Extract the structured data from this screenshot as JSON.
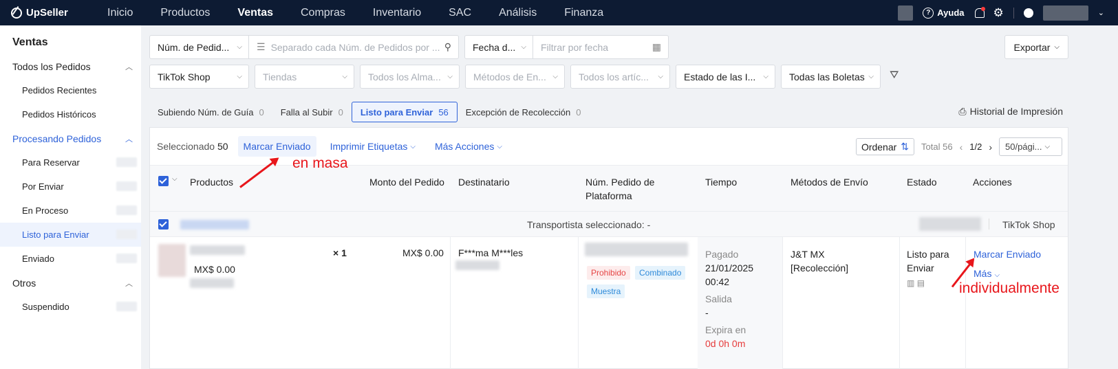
{
  "app": {
    "logo": "UpSeller"
  },
  "nav": [
    "Inicio",
    "Productos",
    "Ventas",
    "Compras",
    "Inventario",
    "SAC",
    "Análisis",
    "Finanza"
  ],
  "nav_active": "Ventas",
  "top_right": {
    "help": "Ayuda"
  },
  "sidebar": {
    "title": "Ventas",
    "groups": [
      {
        "label": "Todos los Pedidos",
        "items": [
          "Pedidos Recientes",
          "Pedidos Históricos"
        ]
      },
      {
        "label": "Procesando Pedidos",
        "items": [
          "Para Reservar",
          "Por Enviar",
          "En Proceso",
          "Listo para Enviar",
          "Enviado"
        ]
      },
      {
        "label": "Otros",
        "items": [
          "Suspendido"
        ]
      }
    ],
    "active_item": "Listo para Enviar"
  },
  "filters": {
    "order_num_select": "Núm. de Pedid...",
    "order_num_placeholder": "Separado cada Núm. de Pedidos por ...",
    "date_select": "Fecha d...",
    "date_placeholder": "Filtrar por fecha",
    "export": "Exportar",
    "platform": "TikTok Shop",
    "stores": "Tiendas",
    "warehouses": "Todos los Alma...",
    "shipping": "Métodos de En...",
    "items": "Todos los artíc...",
    "status": "Estado de las I...",
    "invoices": "Todas las Boletas"
  },
  "tabs": [
    {
      "label": "Subiendo Núm. de Guía",
      "count": "0"
    },
    {
      "label": "Falla al Subir",
      "count": "0"
    },
    {
      "label": "Listo para Enviar",
      "count": "56"
    },
    {
      "label": "Excepción de Recolección",
      "count": "0"
    }
  ],
  "print_history": "Historial de Impresión",
  "toolbar": {
    "selected_label": "Seleccionado",
    "selected_count": "50",
    "mark_shipped": "Marcar Enviado",
    "print_labels": "Imprimir Etiquetas",
    "more_actions": "Más Acciones",
    "sort": "Ordenar",
    "total": "Total 56",
    "page": "1/2",
    "per_page": "50/pági..."
  },
  "columns": [
    "Productos",
    "Monto del Pedido",
    "Destinatario",
    "Núm. Pedido de Plataforma",
    "Tiempo",
    "Métodos de Envío",
    "Estado",
    "Acciones"
  ],
  "group": {
    "carrier": "Transportista seleccionado: -",
    "platform": "TikTok Shop"
  },
  "order": {
    "price": "MX$ 0.00",
    "qty": "× 1",
    "amount": "MX$ 0.00",
    "recipient": "F***ma M***les",
    "tags": [
      "Prohibido",
      "Combinado",
      "Muestra"
    ],
    "time_paid_label": "Pagado",
    "time_paid_date": "21/01/2025",
    "time_paid_time": "00:42",
    "time_out_label": "Salida",
    "time_out_value": "-",
    "expires_label": "Expira en",
    "expires_value": "0d 0h 0m",
    "shipping_method": "J&T MX",
    "shipping_sub": "[Recolección]",
    "status_line1": "Listo para",
    "status_line2": "Enviar",
    "action_mark": "Marcar Enviado",
    "action_more": "Más"
  },
  "annotations": {
    "bulk": "en masa",
    "single": "individualmente"
  },
  "colors": {
    "accent": "#2e62d9",
    "topbar": "#0d1b33",
    "annotation": "#e8161b"
  }
}
